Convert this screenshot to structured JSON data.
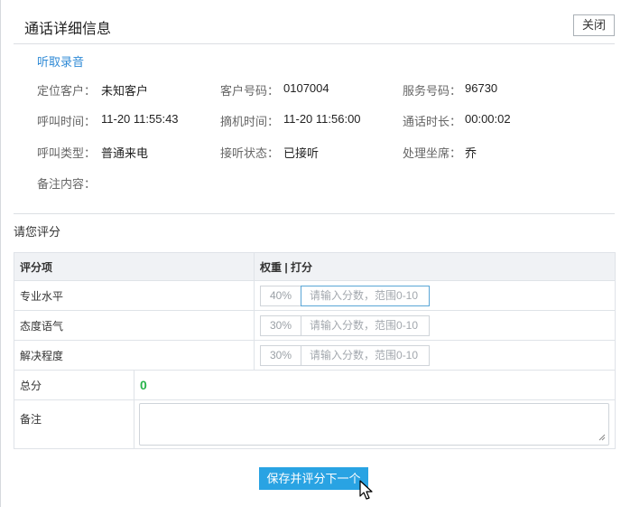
{
  "dialog": {
    "title": "通话详细信息",
    "close_label": "关闭",
    "listen_label": "听取录音"
  },
  "info": {
    "locate_customer_label": "定位客户：",
    "locate_customer_value": "未知客户",
    "customer_number_label": "客户号码：",
    "customer_number_value": "0107004",
    "service_number_label": "服务号码：",
    "service_number_value": "96730",
    "call_time_label": "呼叫时间：",
    "call_time_value": "11-20 11:55:43",
    "pickup_time_label": "摘机时间：",
    "pickup_time_value": "11-20 11:56:00",
    "duration_label": "通话时长：",
    "duration_value": "00:00:02",
    "call_type_label": "呼叫类型：",
    "call_type_value": "普通来电",
    "answer_status_label": "接听状态：",
    "answer_status_value": "已接听",
    "agent_label": "处理坐席：",
    "agent_value": "乔",
    "remark_label": "备注内容："
  },
  "rating": {
    "title": "请您评分",
    "col_item": "评分项",
    "col_weight_score": "权重 | 打分",
    "placeholder": "请输入分数，范围0-10",
    "items": [
      {
        "label": "专业水平",
        "weight": "40%"
      },
      {
        "label": "态度语气",
        "weight": "30%"
      },
      {
        "label": "解决程度",
        "weight": "30%"
      }
    ],
    "total_label": "总分",
    "total_value": "0",
    "remark_label": "备注"
  },
  "actions": {
    "save_next_label": "保存并评分下一个"
  }
}
